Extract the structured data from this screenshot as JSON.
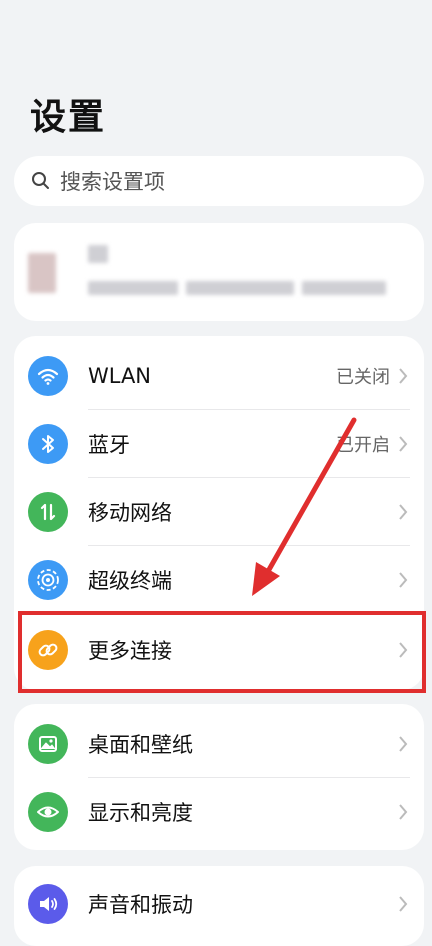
{
  "header": {
    "title": "设置"
  },
  "search": {
    "placeholder": "搜索设置项",
    "icon": "search-icon"
  },
  "profile": {
    "content": "blurred account info"
  },
  "groups": [
    {
      "items": [
        {
          "label": "WLAN",
          "value": "已关闭",
          "icon": "wifi-icon",
          "color": "#3d9af5"
        },
        {
          "label": "蓝牙",
          "value": "已开启",
          "icon": "bluetooth-icon",
          "color": "#3d9af5"
        },
        {
          "label": "移动网络",
          "value": "",
          "icon": "mobile-network-icon",
          "color": "#43b65a"
        },
        {
          "label": "超级终端",
          "value": "",
          "icon": "super-device-icon",
          "color": "#3d9af5"
        },
        {
          "label": "更多连接",
          "value": "",
          "icon": "link-icon",
          "color": "#f7a21b"
        }
      ]
    },
    {
      "items": [
        {
          "label": "桌面和壁纸",
          "value": "",
          "icon": "wallpaper-icon",
          "color": "#43b65a"
        },
        {
          "label": "显示和亮度",
          "value": "",
          "icon": "eye-icon",
          "color": "#43b65a"
        }
      ]
    },
    {
      "items": [
        {
          "label": "声音和振动",
          "value": "",
          "icon": "speaker-icon",
          "color": "#5b5bea"
        }
      ]
    }
  ],
  "annotation": {
    "highlight_color": "#e02e2e",
    "highlighted_item": "更多连接"
  }
}
